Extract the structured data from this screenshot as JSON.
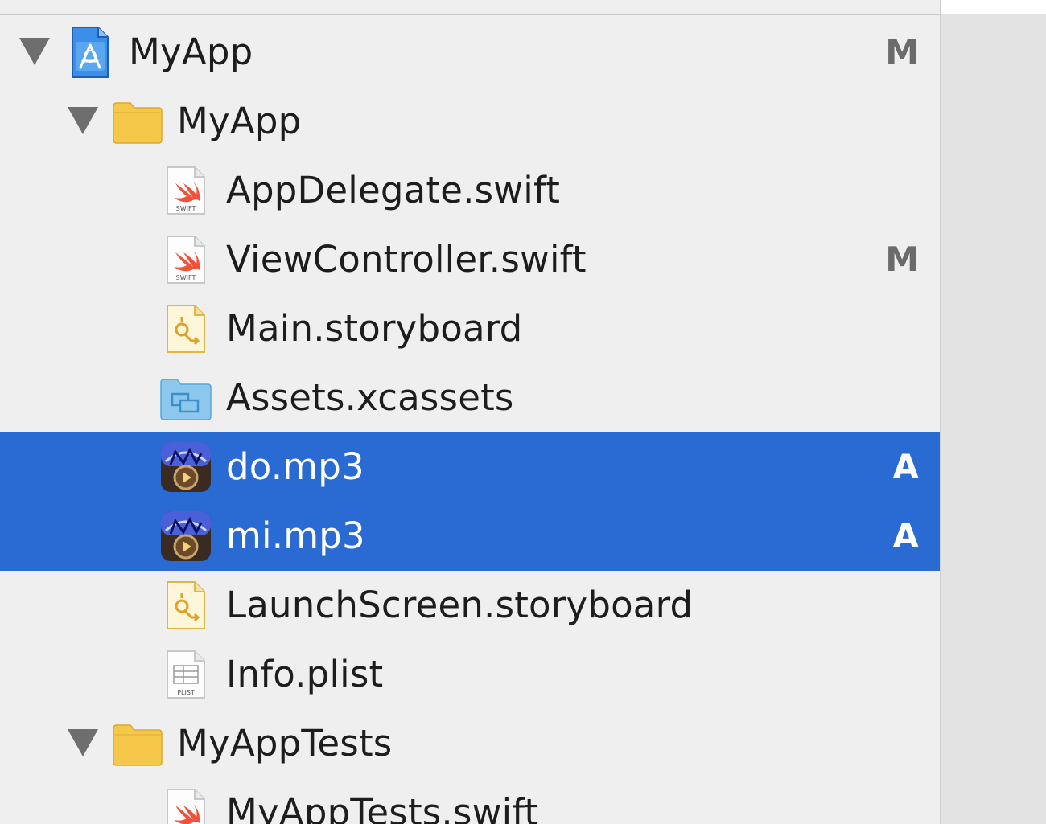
{
  "navigator": {
    "items": [
      {
        "label": "MyApp",
        "status": "M",
        "icon": "xcode-project-icon",
        "indent": 0,
        "expanded": true,
        "selected": false
      },
      {
        "label": "MyApp",
        "status": "",
        "icon": "folder-icon",
        "indent": 1,
        "expanded": true,
        "selected": false
      },
      {
        "label": "AppDelegate.swift",
        "status": "",
        "icon": "swift-file-icon",
        "indent": 2,
        "selected": false
      },
      {
        "label": "ViewController.swift",
        "status": "M",
        "icon": "swift-file-icon",
        "indent": 2,
        "selected": false
      },
      {
        "label": "Main.storyboard",
        "status": "",
        "icon": "storyboard-file-icon",
        "indent": 2,
        "selected": false
      },
      {
        "label": "Assets.xcassets",
        "status": "",
        "icon": "asset-catalog-icon",
        "indent": 2,
        "selected": false
      },
      {
        "label": "do.mp3",
        "status": "A",
        "icon": "audio-file-icon",
        "indent": 2,
        "selected": true
      },
      {
        "label": "mi.mp3",
        "status": "A",
        "icon": "audio-file-icon",
        "indent": 2,
        "selected": true
      },
      {
        "label": "LaunchScreen.storyboard",
        "status": "",
        "icon": "storyboard-file-icon",
        "indent": 2,
        "selected": false
      },
      {
        "label": "Info.plist",
        "status": "",
        "icon": "plist-file-icon",
        "indent": 2,
        "selected": false
      },
      {
        "label": "MyAppTests",
        "status": "",
        "icon": "folder-icon",
        "indent": 1,
        "expanded": true,
        "selected": false
      },
      {
        "label": "MyAppTests.swift",
        "status": "",
        "icon": "swift-file-icon",
        "indent": 2,
        "selected": false
      }
    ]
  },
  "icon_text": {
    "swift": "SWIFT",
    "plist": "PLIST"
  },
  "colors": {
    "selection": "#2a6bd3",
    "folder": "#f5c84a",
    "swift": "#f05138",
    "status": "#6b6b6b"
  }
}
